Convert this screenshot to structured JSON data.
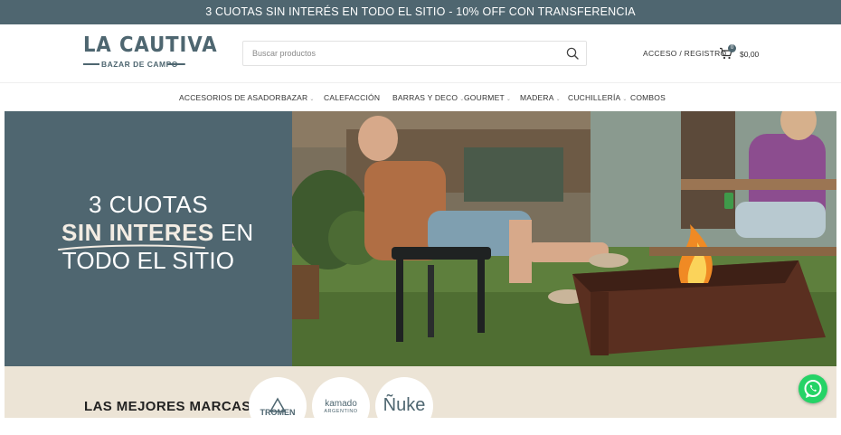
{
  "announcement": "3 CUOTAS SIN INTERÉS EN TODO EL SITIO -  10% OFF CON TRANSFERENCIA",
  "logo": {
    "title": "LA CAUTIVA",
    "subtitle": "BAZAR DE CAMPO"
  },
  "search": {
    "placeholder": "Buscar productos"
  },
  "account": {
    "login_label": "ACCESO / REGISTRO"
  },
  "cart": {
    "count": "0",
    "total": "$0,00"
  },
  "nav": {
    "items": [
      {
        "label": "ACCESORIOS DE ASADOR",
        "has_dropdown": true
      },
      {
        "label": "BAZAR",
        "has_dropdown": true
      },
      {
        "label": "CALEFACCIÓN",
        "has_dropdown": false
      },
      {
        "label": "BARRAS Y DECO",
        "has_dropdown": true
      },
      {
        "label": "GOURMET",
        "has_dropdown": true
      },
      {
        "label": "MADERA",
        "has_dropdown": true
      },
      {
        "label": "CUCHILLERÍA",
        "has_dropdown": true
      },
      {
        "label": "COMBOS",
        "has_dropdown": false
      }
    ]
  },
  "hero": {
    "line1": "3 CUOTAS",
    "line2_bold": "SIN INTERES",
    "line2_rest": " EN",
    "line3": "TODO EL SITIO"
  },
  "brands": {
    "title": "LAS MEJORES MARCAS",
    "items": [
      {
        "name": "TROMEN"
      },
      {
        "name": "kamado",
        "tagline": "ARGENTINO"
      },
      {
        "name": "Ñuke"
      }
    ]
  },
  "colors": {
    "brand": "#4f6670",
    "whatsapp": "#25d366",
    "brands_bg": "#ece4d6"
  }
}
